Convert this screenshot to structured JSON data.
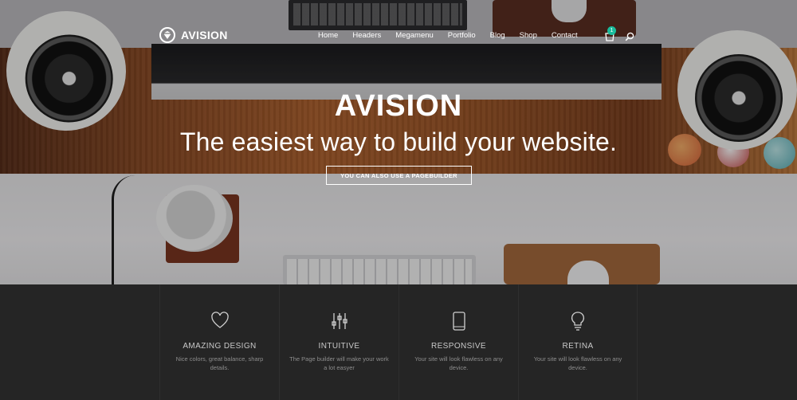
{
  "brand": {
    "name": "AVISION"
  },
  "nav": {
    "items": [
      "Home",
      "Headers",
      "Megamenu",
      "Portfolio",
      "Blog",
      "Shop",
      "Contact"
    ],
    "cart_count": "1"
  },
  "hero": {
    "title": "AVISION",
    "subtitle": "The easiest way to build your website.",
    "button_label": "YOU CAN ALSO USE A PAGEBUILDER"
  },
  "features": [
    {
      "icon": "heart-icon",
      "title": "AMAZING DESIGN",
      "desc": "Nice colors, great balance, sharp details."
    },
    {
      "icon": "sliders-icon",
      "title": "INTUITIVE",
      "desc": "The Page builder will make your work a lot easyer"
    },
    {
      "icon": "tablet-icon",
      "title": "RESPONSIVE",
      "desc": "Your site will look flawless on any device."
    },
    {
      "icon": "lightbulb-icon",
      "title": "RETINA",
      "desc": "Your site will look flawless on any device."
    }
  ],
  "colors": {
    "accent": "#1abc9c",
    "footer_bg": "#252525"
  }
}
